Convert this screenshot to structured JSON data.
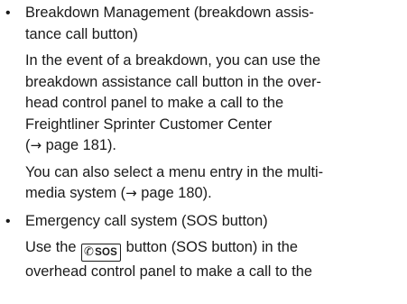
{
  "items": [
    {
      "title_lines": [
        "Breakdown Management (breakdown assis-",
        "tance call button)"
      ],
      "paragraphs": [
        {
          "lines": [
            "In the event of a breakdown, you can use the",
            "breakdown assistance call button in the over-",
            "head control panel to make a call to the",
            "Freightliner Sprinter Customer Center"
          ],
          "ref_arrow": "→",
          "ref_text": " page 181)."
        },
        {
          "lines": [
            "You can also select a menu entry in the multi-"
          ],
          "last_prefix": "media system (",
          "ref_arrow": "→",
          "ref_text": " page 180)."
        }
      ]
    },
    {
      "title_lines": [
        "Emergency call system (SOS button)"
      ],
      "sos_paragraph": {
        "before": "Use the ",
        "button_icon": "phone-icon",
        "button_label": "SOS",
        "after": " button (SOS button) in the",
        "line2": "overhead control panel to make a call to the"
      }
    }
  ],
  "bullet_char": "•"
}
